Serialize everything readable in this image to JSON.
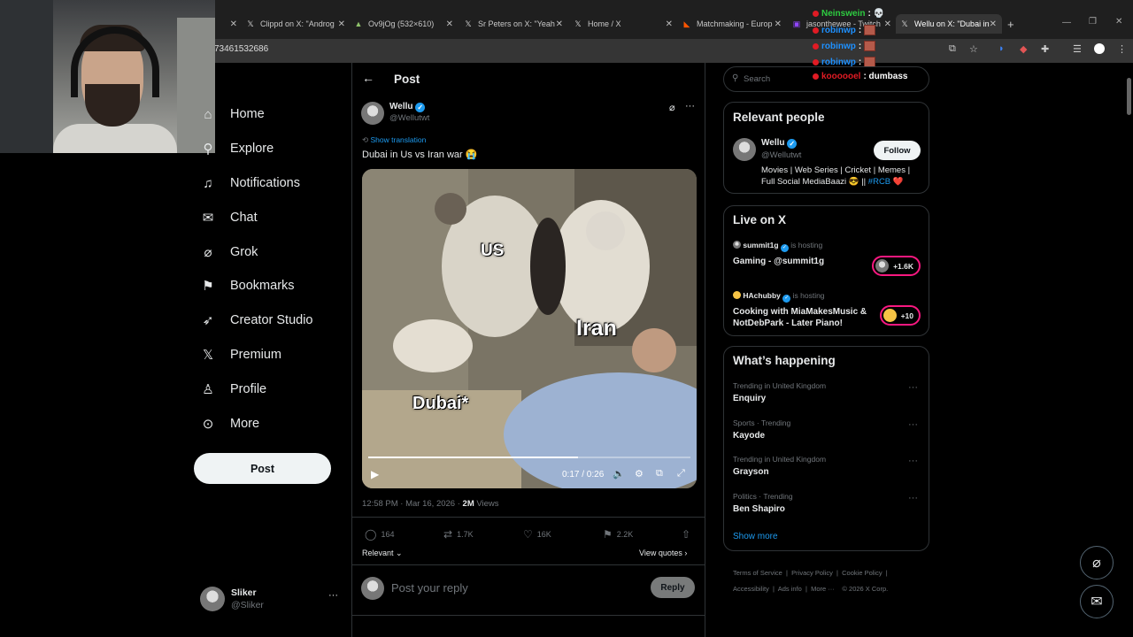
{
  "browser": {
    "tabs": [
      {
        "title": "Clippd on X: \"Androg",
        "icon": "x-logo"
      },
      {
        "title": "Ov9jOg (532×610)",
        "icon": "image"
      },
      {
        "title": "Sr Peters on X: \"Yeah",
        "icon": "x-logo"
      },
      {
        "title": "Home / X",
        "icon": "x-logo"
      },
      {
        "title": "Matchmaking - Europ",
        "icon": "faceit"
      },
      {
        "title": "jasonthewee - Twitch",
        "icon": "twitch"
      },
      {
        "title": "Wellu on X: \"Dubai in",
        "icon": "x-logo",
        "active": true
      }
    ],
    "url": "73461532686"
  },
  "stream_chat": [
    {
      "user": "Neinswein",
      "color": "#2ecc40",
      "message": ":"
    },
    {
      "user": "robinwp",
      "color": "#1e90ff",
      "message": ":"
    },
    {
      "user": "robinwp",
      "color": "#1e90ff",
      "message": ":"
    },
    {
      "user": "robinwp",
      "color": "#1e90ff",
      "message": ":"
    },
    {
      "user": "koooooel",
      "color": "#e01b24",
      "message": ": dumbass"
    }
  ],
  "nav": {
    "items": [
      {
        "label": "Home",
        "icon": "home-icon"
      },
      {
        "label": "Explore",
        "icon": "search-icon"
      },
      {
        "label": "Notifications",
        "icon": "bell-icon"
      },
      {
        "label": "Chat",
        "icon": "mail-icon"
      },
      {
        "label": "Grok",
        "icon": "grok-icon"
      },
      {
        "label": "Bookmarks",
        "icon": "bookmark-icon"
      },
      {
        "label": "Creator Studio",
        "icon": "rocket-icon"
      },
      {
        "label": "Premium",
        "icon": "x-logo-icon"
      },
      {
        "label": "Profile",
        "icon": "person-icon"
      },
      {
        "label": "More",
        "icon": "more-circle-icon"
      }
    ],
    "post_button": "Post",
    "account": {
      "name": "Sliker",
      "handle": "@Sliker"
    }
  },
  "main": {
    "header_title": "Post",
    "tweet": {
      "author": "Wellu",
      "handle": "@Wellutwt",
      "show_translation": "Show translation",
      "text": "Dubai in Us vs Iran war 😭",
      "video": {
        "labels": {
          "us": "US",
          "iran": "Iran",
          "dubai": "Dubai*"
        },
        "time": "0:17 / 0:26",
        "progress": 0.65
      },
      "timestamp": "12:58 PM · Mar 16, 2026 · ",
      "views_count": "2M",
      "views_label": " Views",
      "replies": "164",
      "reposts": "1.7K",
      "likes": "16K",
      "bookmarks": "2.2K",
      "sort_label": "Relevant",
      "view_quotes": "View quotes"
    },
    "reply": {
      "placeholder": "Post your reply",
      "button": "Reply"
    }
  },
  "sidebar": {
    "search_placeholder": "Search",
    "relevant_people": {
      "title": "Relevant people",
      "name": "Wellu",
      "handle": "@Wellutwt",
      "follow": "Follow",
      "bio": "Movies | Web Series | Cricket | Memes | Full Social MediaBaazi 😎 || ",
      "bio_tag": "#RCB",
      "bio_heart": "❤️"
    },
    "live": {
      "title": "Live on X",
      "items": [
        {
          "host": "summit1g",
          "status": "is hosting",
          "title": "Gaming - @summit1g",
          "count": "+1.6K"
        },
        {
          "host": "HAchubby",
          "status": "is hosting",
          "title": "Cooking with MiaMakesMusic & NotDebPark - Later Piano!",
          "count": "+10"
        }
      ]
    },
    "happening": {
      "title": "What’s happening",
      "items": [
        {
          "meta": "Trending in United Kingdom",
          "name": "Enquiry"
        },
        {
          "meta": "Sports · Trending",
          "name": "Kayode"
        },
        {
          "meta": "Trending in United Kingdom",
          "name": "Grayson"
        },
        {
          "meta": "Politics · Trending",
          "name": "Ben Shapiro"
        }
      ],
      "show_more": "Show more"
    },
    "footer": {
      "links": [
        "Terms of Service",
        "Privacy Policy",
        "Cookie Policy",
        "Accessibility",
        "Ads info",
        "More ···",
        "© 2026 X Corp."
      ]
    }
  }
}
